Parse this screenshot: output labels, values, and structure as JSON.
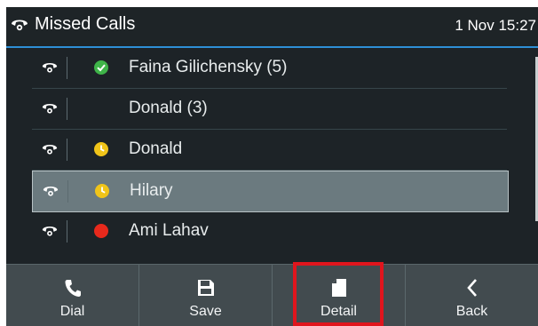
{
  "header": {
    "icon": "phone-handset-icon",
    "title": "Missed Calls",
    "datetime": "1 Nov 15:27"
  },
  "calls": [
    {
      "name": "Faina Gilichensky (5)",
      "status": "check",
      "selected": false
    },
    {
      "name": "Donald (3)",
      "status": "none",
      "selected": false
    },
    {
      "name": "Donald",
      "status": "clock",
      "selected": false
    },
    {
      "name": "Hilary",
      "status": "clock",
      "selected": true
    },
    {
      "name": "Ami Lahav",
      "status": "red-dot",
      "selected": false
    }
  ],
  "softkeys": [
    {
      "label": "Dial",
      "icon": "phone-icon"
    },
    {
      "label": "Save",
      "icon": "floppy-disk-icon"
    },
    {
      "label": "Detail",
      "icon": "document-icon"
    },
    {
      "label": "Back",
      "icon": "chevron-left-icon"
    }
  ],
  "colors": {
    "accent": "#2e8fd6",
    "highlight_box": "#e0151d",
    "status_ok": "#3fb449",
    "status_away": "#f0c419",
    "status_busy": "#e8291c"
  }
}
